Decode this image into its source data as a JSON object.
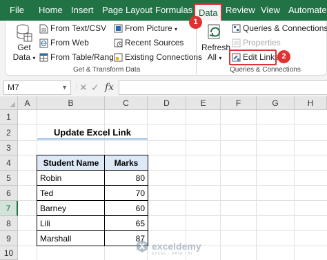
{
  "menu": {
    "tabs": [
      "File",
      "Home",
      "Insert",
      "Page Layout",
      "Formulas",
      "Data",
      "Review",
      "View",
      "Automate"
    ],
    "active_tab": "Data"
  },
  "ribbon": {
    "get_data": {
      "line1": "Get",
      "line2": "Data"
    },
    "get_transform": {
      "from_text_csv": "From Text/CSV",
      "from_web": "From Web",
      "from_table_range": "From Table/Range",
      "from_picture": "From Picture",
      "recent_sources": "Recent Sources",
      "existing_connections": "Existing Connections",
      "label": "Get & Transform Data"
    },
    "queries": {
      "refresh_line1": "Refresh",
      "refresh_line2": "All",
      "queries_connections": "Queries & Connections",
      "properties": "Properties",
      "edit_links": "Edit Links",
      "label": "Queries & Connections"
    },
    "badges": {
      "data_tab": "1",
      "edit_links": "2"
    }
  },
  "formula_bar": {
    "name_box": "M7",
    "cancel": "✕",
    "enter": "✓",
    "fx": "fx",
    "formula": ""
  },
  "sheet": {
    "columns": [
      "A",
      "B",
      "C",
      "D",
      "E",
      "F",
      "G",
      "H"
    ],
    "rows": [
      "1",
      "2",
      "3",
      "4",
      "5",
      "6",
      "7",
      "8",
      "9",
      "10"
    ],
    "selected_row": "7",
    "title": "Update Excel Link",
    "table": {
      "headers": [
        "Student Name",
        "Marks"
      ],
      "rows": [
        {
          "name": "Robin",
          "marks": "80"
        },
        {
          "name": "Ted",
          "marks": "70"
        },
        {
          "name": "Barney",
          "marks": "60"
        },
        {
          "name": "Lili",
          "marks": "65"
        },
        {
          "name": "Marshall",
          "marks": "87"
        }
      ]
    }
  },
  "watermark": {
    "name": "exceldemy",
    "sub": "EXCEL · DATA · BI"
  },
  "colors": {
    "excel_green": "#217346",
    "highlight_red": "#e03232",
    "header_fill": "#dde9f6",
    "title_underline": "#9dc3e6"
  }
}
